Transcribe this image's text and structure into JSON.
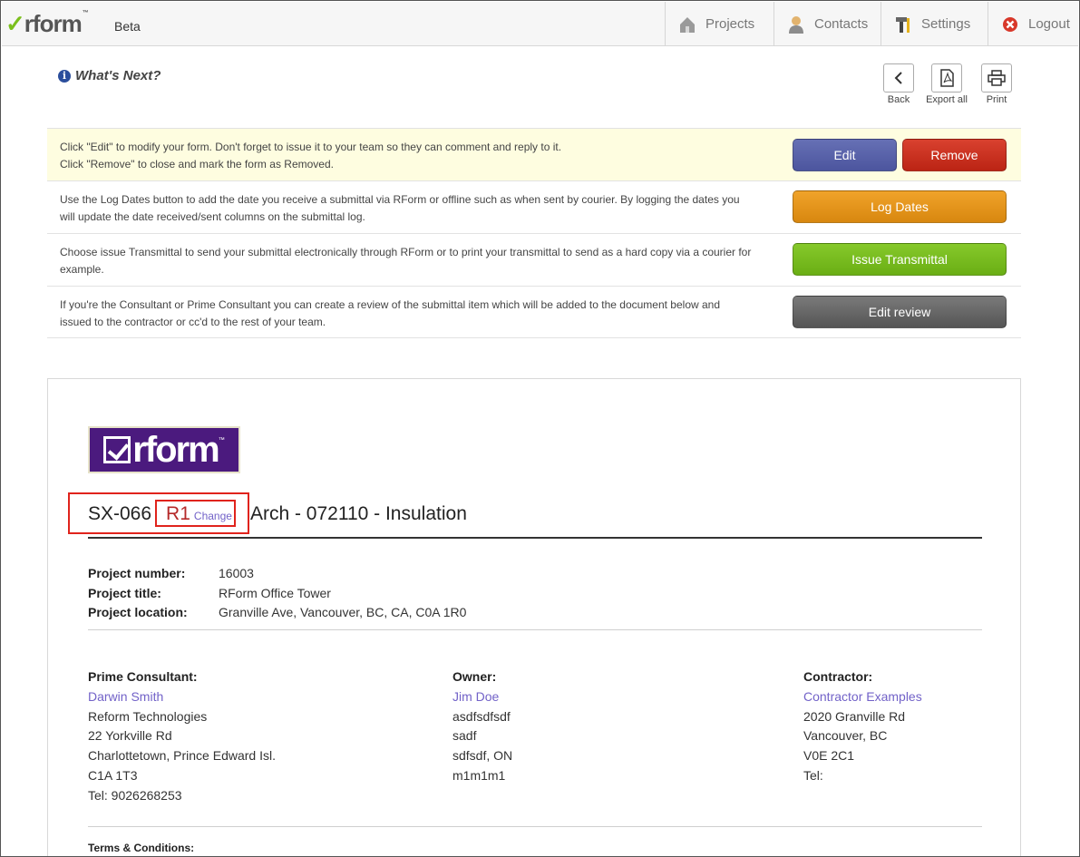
{
  "header": {
    "logo_text": "rform",
    "logo_tm": "™",
    "beta": "Beta",
    "nav": [
      {
        "label": "Projects",
        "icon": "house-icon"
      },
      {
        "label": "Contacts",
        "icon": "person-icon"
      },
      {
        "label": "Settings",
        "icon": "tools-icon"
      },
      {
        "label": "Logout",
        "icon": "close-circle-icon"
      }
    ]
  },
  "whats_next": {
    "title": "What's Next?",
    "toolbar": {
      "back": "Back",
      "export": "Export all",
      "print": "Print"
    }
  },
  "actions": [
    {
      "text_lines": [
        "Click \"Edit\" to modify your form. Don't forget to issue it to your team so they can comment and reply to it.",
        "Click \"Remove\" to close and mark the form as Removed."
      ],
      "buttons": [
        "Edit",
        "Remove"
      ]
    },
    {
      "text_lines": [
        "Use the Log Dates button to add the date you receive a submittal via RForm or offline such as when sent by courier. By logging the dates you",
        "will update the date received/sent columns on the submittal log."
      ],
      "buttons": [
        "Log Dates"
      ]
    },
    {
      "text_lines": [
        "Choose issue Transmittal to send your submittal electronically through RForm or to print your transmittal to send as a hard copy via a courier for",
        "example."
      ],
      "buttons": [
        "Issue Transmittal"
      ]
    },
    {
      "text_lines": [
        "If you're the Consultant or Prime Consultant you can create a review of the submittal item which will be added to the document below and",
        "issued to the contractor or cc'd to the rest of your team."
      ],
      "buttons": [
        "Edit review"
      ]
    }
  ],
  "document": {
    "logo_text": "rform",
    "logo_tm": "™",
    "number": "SX-066",
    "revision": "R1",
    "change_label": "Change",
    "title": "Arch - 072110 - Insulation",
    "project": [
      {
        "label": "Project number:",
        "value": "16003"
      },
      {
        "label": "Project title:",
        "value": "RForm Office Tower"
      },
      {
        "label": "Project location:",
        "value": "Granville Ave, Vancouver, BC, CA, C0A 1R0"
      }
    ],
    "parties": [
      {
        "heading": "Prime Consultant:",
        "name": "Darwin Smith",
        "lines": [
          "Reform Technologies",
          "22 Yorkville Rd",
          "Charlottetown, Prince Edward Isl.",
          "C1A 1T3",
          "Tel: 9026268253"
        ]
      },
      {
        "heading": "Owner:",
        "name": "Jim Doe",
        "lines": [
          "asdfsdfsdf",
          "sadf",
          "sdfsdf, ON",
          "m1m1m1"
        ]
      },
      {
        "heading": "Contractor:",
        "name": "Contractor Examples",
        "lines": [
          "2020 Granville Rd",
          "Vancouver, BC",
          "V0E 2C1",
          "Tel:"
        ]
      }
    ],
    "terms": "Terms & Conditions:"
  },
  "colors": {
    "edit": "#5560a8",
    "remove": "#c9301f",
    "log_dates": "#e5951b",
    "issue": "#78bb20",
    "review": "#666666",
    "link": "#7262c8",
    "highlight": "#e0231c"
  }
}
